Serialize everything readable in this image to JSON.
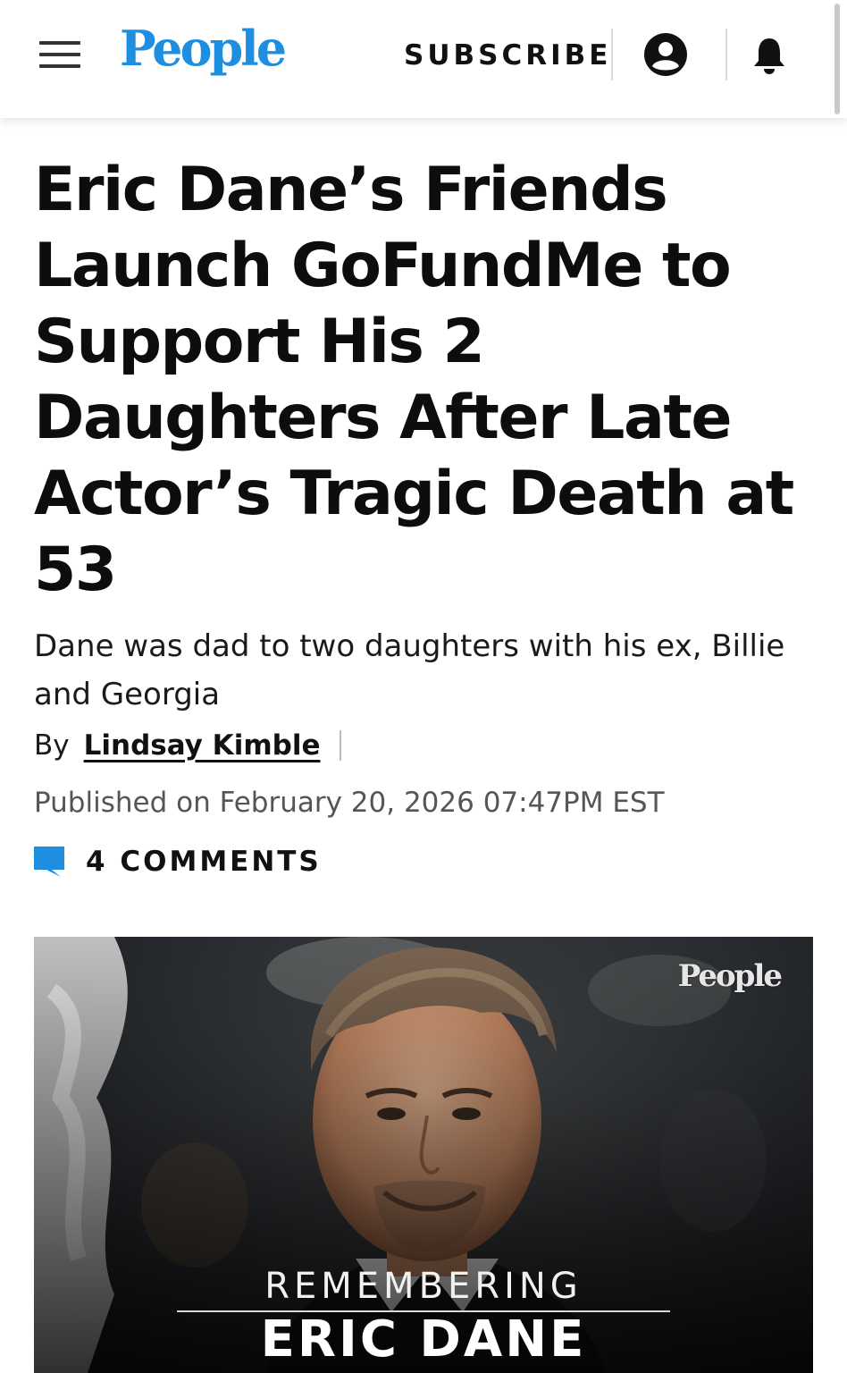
{
  "header": {
    "brand": "People",
    "subscribe_label": "SUBSCRIBE",
    "icons": [
      "menu-icon",
      "account-icon",
      "bell-icon"
    ],
    "brand_color": "#1e8fe0"
  },
  "article": {
    "title": "Eric Dane’s Friends Launch GoFundMe to Support His 2 Daughters After Late Actor’s Tragic Death at 53",
    "dek": "Dane was dad to two daughters with his ex, Billie and Georgia",
    "byline_prefix": "By",
    "author": "Lindsay Kimble",
    "published": "Published on February 20, 2026 07:47PM EST",
    "comments_label": "4 COMMENTS",
    "comments_icon": "comment-icon",
    "comment_icon_color": "#1e8fe0"
  },
  "hero": {
    "watermark": "People",
    "kicker": "REMEMBERING",
    "name": "ERIC DANE"
  }
}
